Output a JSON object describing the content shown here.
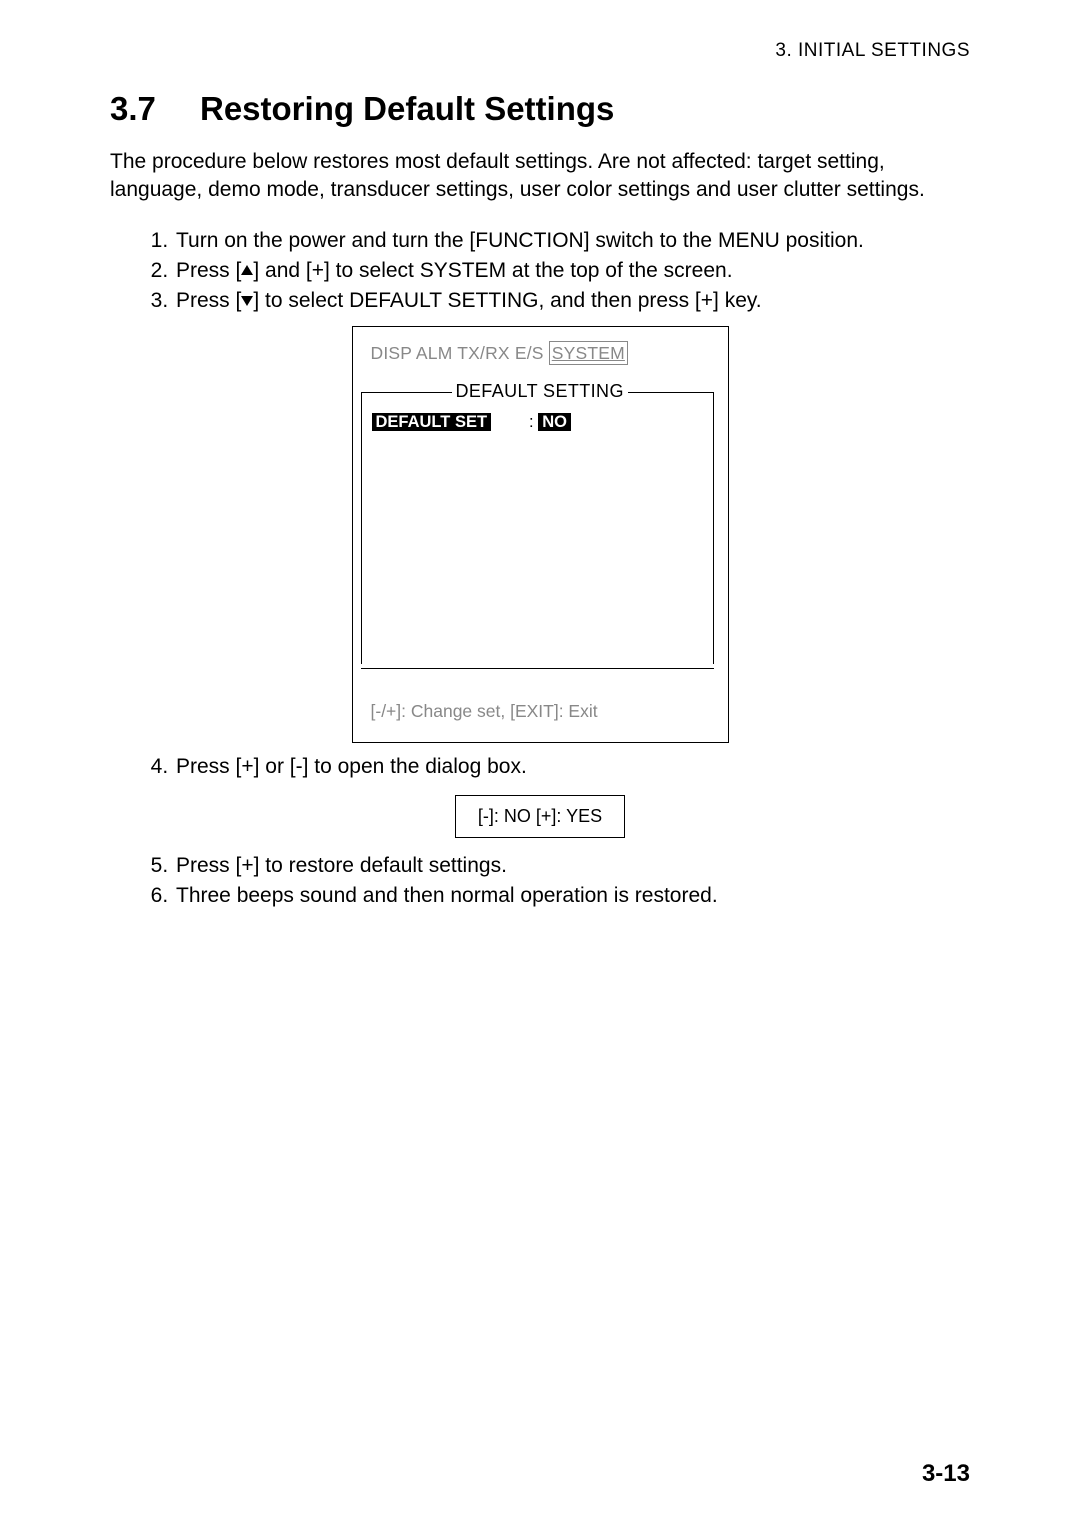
{
  "header": "3.  INITIAL  SETTINGS",
  "heading_number": "3.7",
  "heading_title": "Restoring Default Settings",
  "intro": "The procedure below restores most default settings. Are not affected: target setting, language, demo mode, transducer settings, user color settings and user clutter settings.",
  "steps_a": [
    "Turn on the power and turn the [FUNCTION] switch to the MENU position.",
    "__UP__",
    "__DOWN__"
  ],
  "step2_pre": "Press [",
  "step2_mid": "] and [+] to select SYSTEM at the top of the screen.",
  "step3_pre": "Press [",
  "step3_mid": "] to select DEFAULT SETTING, and then press [+] key.",
  "screen": {
    "tabs": "DISP  ALM  TX/RX  E/S",
    "tab_selected": "SYSTEM",
    "fieldset_title": "DEFAULT SETTING",
    "row_label": "DEFAULT SET",
    "row_value": "NO",
    "footer": "[-/+]: Change set, [EXIT]: Exit"
  },
  "steps_b": [
    "Press [+] or [-] to open the dialog box."
  ],
  "dialog": "[-]: NO  [+]: YES",
  "steps_c": [
    "Press [+] to restore default settings.",
    "Three beeps sound and then normal operation is restored."
  ],
  "page_number": "3-13"
}
